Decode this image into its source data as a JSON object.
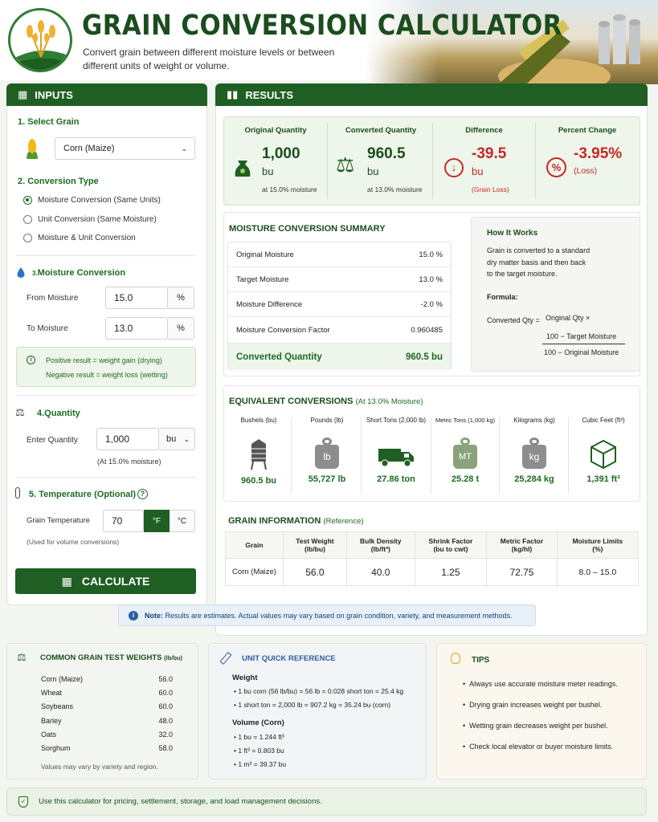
{
  "header": {
    "title": "GRAIN CONVERSION CALCULATOR",
    "subtitle_1": "Convert grain between different moisture levels or between",
    "subtitle_2": "different units of weight or volume."
  },
  "inputs": {
    "heading": "INPUTS",
    "select_grain_label": "1.  Select Grain",
    "grain_value": "Corn (Maize)",
    "conversion_type_label": "2.  Conversion Type",
    "options": [
      "Moisture Conversion (Same Units)",
      "Unit Conversion (Same Moisture)",
      "Moisture & Unit Conversion"
    ],
    "moisture_prefix": "3.",
    "moisture_label": "Moisture Conversion",
    "from_label": "From Moisture",
    "from_value": "15.0",
    "from_unit": "%",
    "to_label": "To Moisture",
    "to_value": "13.0",
    "to_unit": "%",
    "note_1": "Positive result = weight gain (drying)",
    "note_2": "Negative result = weight loss (wetting)",
    "quantity_label": "4.Quantity",
    "enter_qty_label": "Enter Quantity",
    "qty_value": "1,000",
    "qty_unit": "bu",
    "qty_note": "(At 15.0% moisture)",
    "temp_label": "5. Temperature (Optional)",
    "temp_field_label": "Grain Temperature",
    "temp_value": "70",
    "unit_f": "°F",
    "unit_c": "°C",
    "temp_note": "(Used for volume conversions)",
    "calculate": "CALCULATE"
  },
  "results": {
    "heading": "RESULTS",
    "cards": [
      {
        "title": "Original Quantity",
        "value": "1,000",
        "unit": "bu",
        "note": "at 15.0% moisture"
      },
      {
        "title": "Converted Quantity",
        "value": "960.5",
        "unit": "bu",
        "note": "at 13.0% moisture"
      },
      {
        "title": "Difference",
        "value": "-39.5",
        "unit": "bu",
        "note": "(Grain Loss)"
      },
      {
        "title": "Percent Change",
        "value": "-3.95%",
        "unit": "(Loss)",
        "note": ""
      }
    ],
    "summary_title": "MOISTURE CONVERSION SUMMARY",
    "summary_rows": [
      {
        "label": "Original Moisture",
        "value": "15.0 %"
      },
      {
        "label": "Target Moisture",
        "value": "13.0 %"
      },
      {
        "label": "Moisture Difference",
        "value": "-2.0 %"
      },
      {
        "label": "Moisture Conversion Factor",
        "value": "0.960485"
      }
    ],
    "converted_label": "Converted Quantity",
    "converted_value": "960.5 bu",
    "how": {
      "title": "How It Works",
      "text_1": "Grain is converted to a standard",
      "text_2": "dry matter basis and then back",
      "text_3": "to the target moisture.",
      "formula_label": "Formula:",
      "lhs": "Converted Qty =",
      "orig": "Original Qty ×",
      "numerator": "100 − Target Moisture",
      "denominator": "100 − Original Moisture"
    },
    "equiv_title": "EQUIVALENT CONVERSIONS",
    "equiv_sub": "(At 13.0% Moisture)",
    "equiv": [
      {
        "label": "Bushels (bu)",
        "value": "960.5 bu"
      },
      {
        "label": "Pounds (lb)",
        "value": "55,727 lb",
        "icon": "lb"
      },
      {
        "label": "Short Tons (2,000 lb)",
        "value": "27.86 ton"
      },
      {
        "label": "Metric Tons (1,000 kg)",
        "value": "25.28 t",
        "icon": "MT"
      },
      {
        "label": "Kilograms (kg)",
        "value": "25,284 kg",
        "icon": "kg"
      },
      {
        "label": "Cubic Feet (ft³)",
        "value": "1,391 ft³"
      }
    ],
    "info_title": "GRAIN INFORMATION",
    "info_sub": "(Reference)",
    "info_headers": [
      [
        "Grain",
        ""
      ],
      [
        "Test Weight",
        "(lb/bu)"
      ],
      [
        "Bulk Density",
        "(lb/ft³)"
      ],
      [
        "Shrink Factor",
        "(bu to cwt)"
      ],
      [
        "Metric Factor",
        "(kg/hl)"
      ],
      [
        "Moisture Limits",
        "(%)"
      ]
    ],
    "info_row": [
      "Corn (Maize)",
      "56.0",
      "40.0",
      "1.25",
      "72.75",
      "8.0 – 15.0"
    ],
    "note_bold": "Note:",
    "note_text": "Results are estimates. Actual values may vary based on grain condition, variety, and measurement methods."
  },
  "test_weights": {
    "title": "COMMON GRAIN TEST WEIGHTS",
    "unit": "(lb/bu)",
    "rows": [
      [
        "Corn (Maize)",
        "56.0"
      ],
      [
        "Wheat",
        "60.0"
      ],
      [
        "Soybeans",
        "60.0"
      ],
      [
        "Barley",
        "48.0"
      ],
      [
        "Oats",
        "32.0"
      ],
      [
        "Sorghum",
        "58.0"
      ]
    ],
    "note": "Values may vary by variety and region."
  },
  "quick_ref": {
    "title": "UNIT QUICK REFERENCE",
    "weight_title": "Weight",
    "weight": [
      "1 bu corn (56 lb/bu) = 56 lb = 0.028 short ton = 25.4 kg",
      "1 short ton = 2,000 lb = 907.2 kg = 35.24 bu (corn)"
    ],
    "volume_title": "Volume  (Corn)",
    "volume": [
      "1 bu = 1.244 ft³",
      "1 ft³ = 0.803 bu",
      "1 m³ = 39.37 bu"
    ]
  },
  "tips": {
    "title": "TIPS",
    "items": [
      "Always use accurate moisture meter readings.",
      "Drying grain increases weight per bushel.",
      "Wetting grain decreases weight per bushel.",
      "Check local elevator or buyer moisture limits."
    ]
  },
  "footer": "Use this calculator for pricing, settlement, storage, and load management decisions.",
  "colors": {
    "brand": "#1f5f23",
    "loss": "#c62828"
  }
}
